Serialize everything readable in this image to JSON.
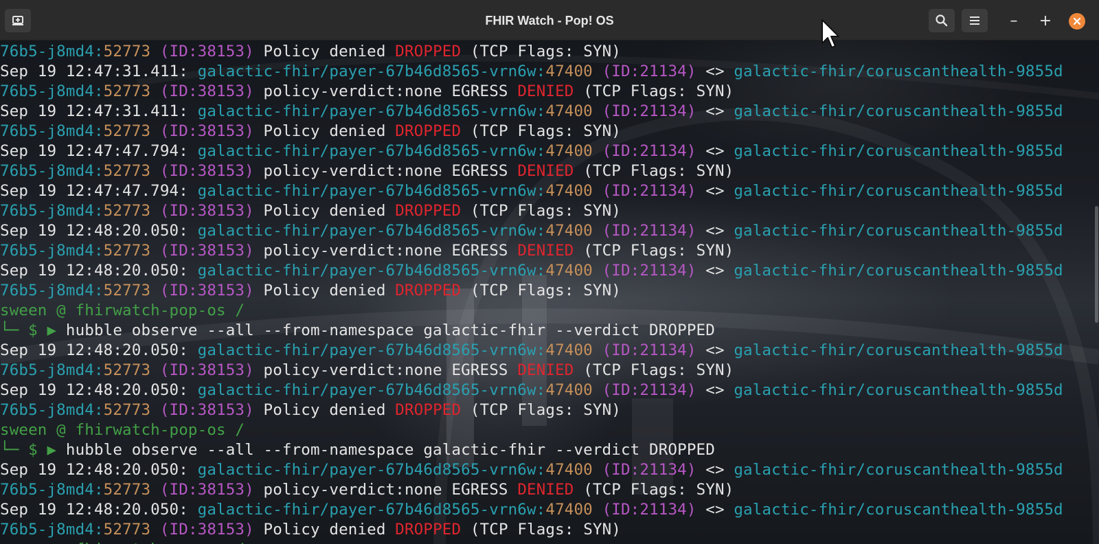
{
  "window": {
    "title": "FHIR Watch - Pop! OS",
    "controls": {
      "minimize": "–",
      "maximize": "+"
    }
  },
  "icons": {
    "new_tab": "new-tab-icon",
    "search": "search-icon",
    "menu": "hamburger-menu-icon",
    "close": "close-icon"
  },
  "colors": {
    "namespace": "#2aa0b0",
    "port": "#c6905a",
    "identity": "#b657c4",
    "verdict": "#e0252e",
    "prompt": "#43a047",
    "close_button": "#f0883a"
  },
  "terminal": {
    "prompt": {
      "user_host": "sween @ fhirwatch-pop-os /",
      "marker": "└─ $ ▶ ",
      "command": "hubble observe --all --from-namespace galactic-fhir --verdict DROPPED"
    },
    "lines": [
      {
        "type": "tail",
        "pod": "76b5-j8md4:",
        "port": "52773",
        "id": " (ID:38153)",
        "msg": " Policy denied ",
        "verdict": "DROPPED",
        "rest": " (TCP Flags: SYN)"
      },
      {
        "type": "flow",
        "ts": "Sep 19 12:47:31.411: ",
        "src": "galactic-fhir/payer-67b46d8565-vrn6w:",
        "port": "47400",
        "id": " (ID:21134)",
        "arrow": " <> ",
        "dst": "galactic-fhir/coruscanthealth-9855d"
      },
      {
        "type": "tail",
        "pod": "76b5-j8md4:",
        "port": "52773",
        "id": " (ID:38153)",
        "msg": " policy-verdict:none EGRESS ",
        "verdict": "DENIED",
        "rest": " (TCP Flags: SYN)"
      },
      {
        "type": "flow",
        "ts": "Sep 19 12:47:31.411: ",
        "src": "galactic-fhir/payer-67b46d8565-vrn6w:",
        "port": "47400",
        "id": " (ID:21134)",
        "arrow": " <> ",
        "dst": "galactic-fhir/coruscanthealth-9855d"
      },
      {
        "type": "tail",
        "pod": "76b5-j8md4:",
        "port": "52773",
        "id": " (ID:38153)",
        "msg": " Policy denied ",
        "verdict": "DROPPED",
        "rest": " (TCP Flags: SYN)"
      },
      {
        "type": "flow",
        "ts": "Sep 19 12:47:47.794: ",
        "src": "galactic-fhir/payer-67b46d8565-vrn6w:",
        "port": "47400",
        "id": " (ID:21134)",
        "arrow": " <> ",
        "dst": "galactic-fhir/coruscanthealth-9855d"
      },
      {
        "type": "tail",
        "pod": "76b5-j8md4:",
        "port": "52773",
        "id": " (ID:38153)",
        "msg": " policy-verdict:none EGRESS ",
        "verdict": "DENIED",
        "rest": " (TCP Flags: SYN)"
      },
      {
        "type": "flow",
        "ts": "Sep 19 12:47:47.794: ",
        "src": "galactic-fhir/payer-67b46d8565-vrn6w:",
        "port": "47400",
        "id": " (ID:21134)",
        "arrow": " <> ",
        "dst": "galactic-fhir/coruscanthealth-9855d"
      },
      {
        "type": "tail",
        "pod": "76b5-j8md4:",
        "port": "52773",
        "id": " (ID:38153)",
        "msg": " Policy denied ",
        "verdict": "DROPPED",
        "rest": " (TCP Flags: SYN)"
      },
      {
        "type": "flow",
        "ts": "Sep 19 12:48:20.050: ",
        "src": "galactic-fhir/payer-67b46d8565-vrn6w:",
        "port": "47400",
        "id": " (ID:21134)",
        "arrow": " <> ",
        "dst": "galactic-fhir/coruscanthealth-9855d"
      },
      {
        "type": "tail",
        "pod": "76b5-j8md4:",
        "port": "52773",
        "id": " (ID:38153)",
        "msg": " policy-verdict:none EGRESS ",
        "verdict": "DENIED",
        "rest": " (TCP Flags: SYN)"
      },
      {
        "type": "flow",
        "ts": "Sep 19 12:48:20.050: ",
        "src": "galactic-fhir/payer-67b46d8565-vrn6w:",
        "port": "47400",
        "id": " (ID:21134)",
        "arrow": " <> ",
        "dst": "galactic-fhir/coruscanthealth-9855d"
      },
      {
        "type": "tail",
        "pod": "76b5-j8md4:",
        "port": "52773",
        "id": " (ID:38153)",
        "msg": " Policy denied ",
        "verdict": "DROPPED",
        "rest": " (TCP Flags: SYN)"
      },
      {
        "type": "prompt"
      },
      {
        "type": "command"
      },
      {
        "type": "flow",
        "ts": "Sep 19 12:48:20.050: ",
        "src": "galactic-fhir/payer-67b46d8565-vrn6w:",
        "port": "47400",
        "id": " (ID:21134)",
        "arrow": " <> ",
        "dst": "galactic-fhir/coruscanthealth-9855d"
      },
      {
        "type": "tail",
        "pod": "76b5-j8md4:",
        "port": "52773",
        "id": " (ID:38153)",
        "msg": " policy-verdict:none EGRESS ",
        "verdict": "DENIED",
        "rest": " (TCP Flags: SYN)"
      },
      {
        "type": "flow",
        "ts": "Sep 19 12:48:20.050: ",
        "src": "galactic-fhir/payer-67b46d8565-vrn6w:",
        "port": "47400",
        "id": " (ID:21134)",
        "arrow": " <> ",
        "dst": "galactic-fhir/coruscanthealth-9855d"
      },
      {
        "type": "tail",
        "pod": "76b5-j8md4:",
        "port": "52773",
        "id": " (ID:38153)",
        "msg": " Policy denied ",
        "verdict": "DROPPED",
        "rest": " (TCP Flags: SYN)"
      },
      {
        "type": "prompt"
      },
      {
        "type": "command"
      },
      {
        "type": "flow",
        "ts": "Sep 19 12:48:20.050: ",
        "src": "galactic-fhir/payer-67b46d8565-vrn6w:",
        "port": "47400",
        "id": " (ID:21134)",
        "arrow": " <> ",
        "dst": "galactic-fhir/coruscanthealth-9855d"
      },
      {
        "type": "tail",
        "pod": "76b5-j8md4:",
        "port": "52773",
        "id": " (ID:38153)",
        "msg": " policy-verdict:none EGRESS ",
        "verdict": "DENIED",
        "rest": " (TCP Flags: SYN)"
      },
      {
        "type": "flow",
        "ts": "Sep 19 12:48:20.050: ",
        "src": "galactic-fhir/payer-67b46d8565-vrn6w:",
        "port": "47400",
        "id": " (ID:21134)",
        "arrow": " <> ",
        "dst": "galactic-fhir/coruscanthealth-9855d"
      },
      {
        "type": "tail",
        "pod": "76b5-j8md4:",
        "port": "52773",
        "id": " (ID:38153)",
        "msg": " Policy denied ",
        "verdict": "DROPPED",
        "rest": " (TCP Flags: SYN)"
      },
      {
        "type": "prompt"
      }
    ]
  }
}
